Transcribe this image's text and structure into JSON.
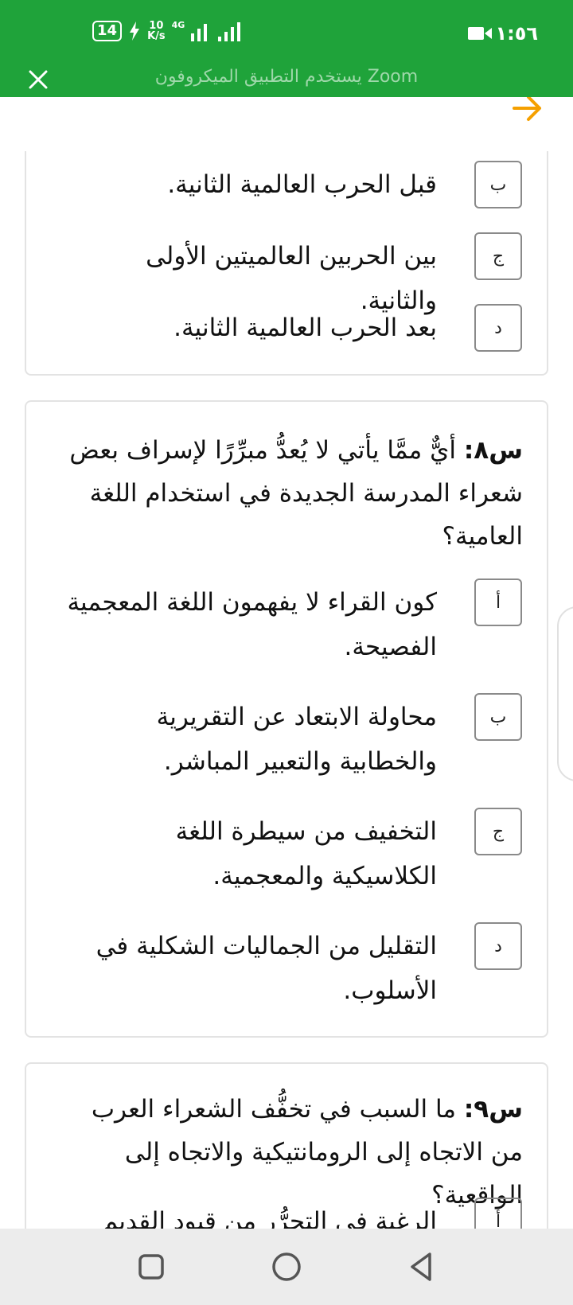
{
  "status_bar": {
    "badge": "14",
    "net_speed_top": "10",
    "net_speed_bottom": "K/s",
    "network": "4G",
    "time": "١:٥٦"
  },
  "zoom_banner": {
    "text": "يستخدم التطبيق الميكروفون Zoom",
    "bg_color": "#1fa33a"
  },
  "toolbar": {
    "next_arrow_color": "#f5a000"
  },
  "question7": {
    "options": [
      {
        "letter": "ب",
        "text": "قبل الحرب العالمية الثانية."
      },
      {
        "letter": "ج",
        "text": "بين الحربين العالميتين الأولى والثانية."
      },
      {
        "letter": "د",
        "text": "بعد الحرب العالمية الثانية."
      }
    ]
  },
  "question8": {
    "number": "س٨:",
    "text": "أيٌّ ممَّا يأتي لا يُعدُّ مبرِّرًا لإسراف بعض شعراء المدرسة الجديدة في استخدام اللغة العامية؟",
    "options": [
      {
        "letter": "أ",
        "text": "كون القراء لا يفهمون اللغة المعجمية الفصيحة."
      },
      {
        "letter": "ب",
        "text": "محاولة الابتعاد عن التقريرية والخطابية والتعبير المباشر."
      },
      {
        "letter": "ج",
        "text": "التخفيف من سيطرة اللغة الكلاسيكية والمعجمية."
      },
      {
        "letter": "د",
        "text": "التقليل من الجماليات الشكلية في الأسلوب."
      }
    ]
  },
  "question9": {
    "number": "س٩:",
    "text": "ما السبب في تخفُّف الشعراء العرب من الاتجاه إلى الرومانتيكية والاتجاه إلى الواقعية؟",
    "options": [
      {
        "letter": "أ",
        "text": "الرغبة في التحرُّر من قيود القديم في"
      }
    ]
  }
}
